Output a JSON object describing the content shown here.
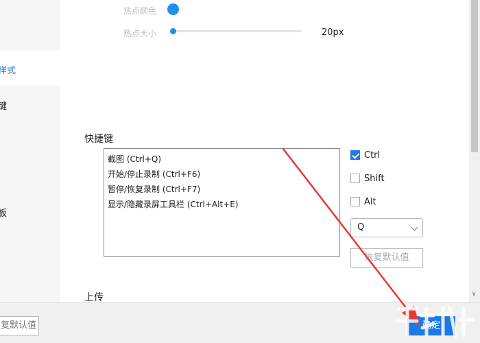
{
  "sidebar": {
    "items": [
      {
        "label": "样式",
        "active": true
      },
      {
        "label": "键",
        "active": false
      },
      {
        "label": "板",
        "active": false
      }
    ]
  },
  "hotspot": {
    "color_label": "热点颜色",
    "color": "#1e90f0",
    "size_label": "热点大小",
    "size_value": "20px"
  },
  "shortcuts": {
    "title": "快捷键",
    "items": [
      "截图 (Ctrl+Q)",
      "开始/停止录制 (Ctrl+F6)",
      "暂停/恢复录制 (Ctrl+F7)",
      "显示/隐藏录屏工具栏 (Ctrl+Alt+E)"
    ],
    "modifiers": [
      {
        "label": "Ctrl",
        "checked": true
      },
      {
        "label": "Shift",
        "checked": false
      },
      {
        "label": "Alt",
        "checked": false
      }
    ],
    "key_selected": "Q",
    "restore_label": "恢复默认值"
  },
  "upload": {
    "title": "上传"
  },
  "footer": {
    "restore_label": "复默认值",
    "ok_label": "确定"
  },
  "colors": {
    "accent": "#1e78e6",
    "arrow": "#e53935"
  }
}
